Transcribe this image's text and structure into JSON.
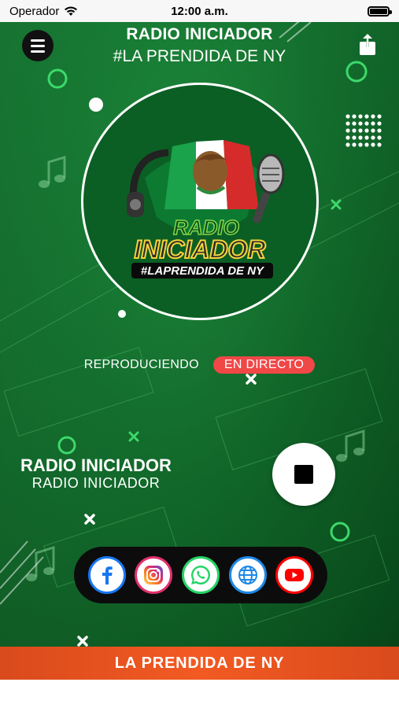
{
  "status_bar": {
    "carrier": "Operador",
    "time": "12:00 a.m."
  },
  "header": {
    "title": "RADIO INICIADOR",
    "subtitle": "#LA PRENDIDA DE NY"
  },
  "logo": {
    "line1": "RADIO",
    "line2": "INICIADOR",
    "tagline": "#LAPRENDIDA DE NY"
  },
  "player": {
    "status_label": "REPRODUCIENDO",
    "live_badge": "EN DIRECTO",
    "station_name": "RADIO INICIADOR",
    "station_sub": "RADIO  INICIADOR"
  },
  "social": [
    {
      "name": "facebook",
      "icon": "facebook-icon",
      "color": "#1877f2"
    },
    {
      "name": "instagram",
      "icon": "instagram-icon",
      "color": "#d62976"
    },
    {
      "name": "whatsapp",
      "icon": "whatsapp-icon",
      "color": "#25d366"
    },
    {
      "name": "website",
      "icon": "globe-icon",
      "color": "#1e88e5"
    },
    {
      "name": "youtube",
      "icon": "youtube-icon",
      "color": "#ff0000"
    }
  ],
  "banner": {
    "text": "LA PRENDIDA DE NY"
  },
  "colors": {
    "accent": "#f04747",
    "background": "#0f6a2a",
    "banner": "#f25a22"
  }
}
